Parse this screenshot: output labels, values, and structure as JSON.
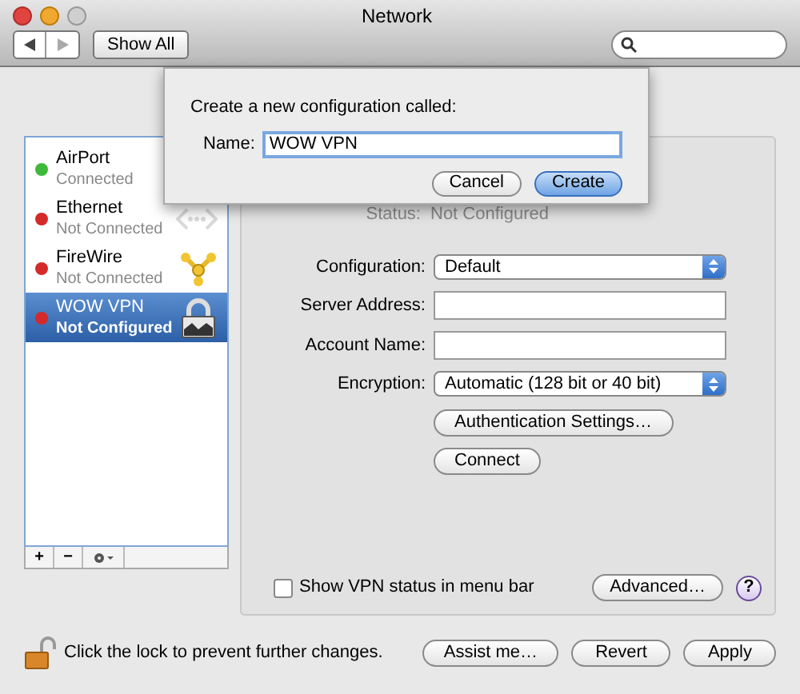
{
  "window": {
    "title": "Network"
  },
  "toolbar": {
    "show_all": "Show All"
  },
  "services": [
    {
      "name": "AirPort",
      "status": "Connected",
      "color": "#3fb93a",
      "selected": false,
      "kind": "wifi"
    },
    {
      "name": "Ethernet",
      "status": "Not Connected",
      "color": "#d42a2a",
      "selected": false,
      "kind": "ethernet"
    },
    {
      "name": "FireWire",
      "status": "Not Connected",
      "color": "#d42a2a",
      "selected": false,
      "kind": "firewire"
    },
    {
      "name": "WOW VPN",
      "status": "Not Configured",
      "color": "#d42a2a",
      "selected": true,
      "kind": "vpn"
    }
  ],
  "list_tools": [
    "+",
    "−"
  ],
  "status": {
    "label": "Status:",
    "value": "Not Configured"
  },
  "form": [
    {
      "label": "Configuration:",
      "kind": "popup",
      "value": "Default"
    },
    {
      "label": "Server Address:",
      "kind": "text"
    },
    {
      "label": "Account Name:",
      "kind": "text"
    },
    {
      "label": "Encryption:",
      "kind": "popup",
      "value": "Automatic (128 bit or 40 bit)"
    }
  ],
  "panel_buttons": [
    "Authentication Settings…",
    "Connect"
  ],
  "show_vpn_status": {
    "label": "Show VPN status in menu bar",
    "checked": false
  },
  "advanced": "Advanced…",
  "help": "?",
  "lock": {
    "text": "Click the lock to prevent further changes.",
    "locked": false
  },
  "footer_buttons": [
    "Assist me…",
    "Revert",
    "Apply"
  ],
  "sheet": {
    "prompt": "Create a new configuration called:",
    "name_label": "Name:",
    "name_value": "WOW VPN",
    "buttons": [
      {
        "label": "Cancel",
        "default": false
      },
      {
        "label": "Create",
        "default": true
      }
    ]
  }
}
